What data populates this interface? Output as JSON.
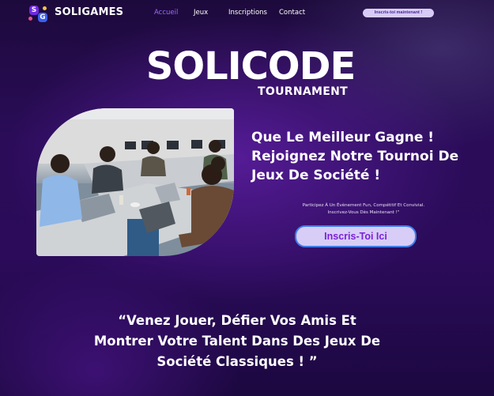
{
  "header": {
    "logo_letters": [
      "S",
      "G"
    ],
    "brand": "SOLIGAMES",
    "nav": [
      {
        "label": "Accueil",
        "active": true
      },
      {
        "label": "Jeux",
        "active": false
      },
      {
        "label": "Inscriptions",
        "active": false
      },
      {
        "label": "Contact",
        "active": false
      }
    ],
    "cta": "Inscris-toi maintenant !"
  },
  "hero": {
    "title": "SOLICODE",
    "subtitle": "TOURNAMENT"
  },
  "intro": {
    "headline_lines": [
      "Que Le Meilleur Gagne !",
      "Rejoignez Notre Tournoi De",
      "Jeux De Société !"
    ],
    "blurb_lines": [
      "Participez À Un Évènement Fun, Compétitif Et Convivial.",
      "Inscrivez-Vous Dès Maintenant !\""
    ],
    "cta": "Inscris-Toi Ici"
  },
  "quote": {
    "lines": [
      "“Venez Jouer, Défier Vos Amis Et",
      "Montrer Votre Talent Dans Des Jeux De",
      "Société Classiques ! ”"
    ]
  },
  "colors": {
    "background": "#2a0c58",
    "nav_active": "#9c6cf5",
    "cta_bg": "#d8cdf6",
    "cta_text": "#7b22d8",
    "cta_border": "#3f7de8"
  }
}
